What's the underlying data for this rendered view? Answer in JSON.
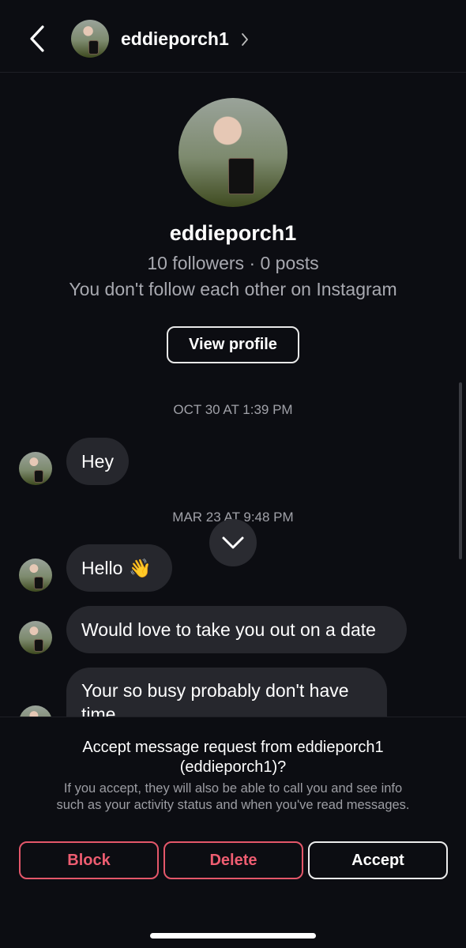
{
  "header": {
    "username": "eddieporch1"
  },
  "profile": {
    "name": "eddieporch1",
    "stats": "10 followers · 0 posts",
    "note": "You don't follow each other on Instagram",
    "view_profile_label": "View profile"
  },
  "thread": {
    "timestamp_1": "OCT 30 AT 1:39 PM",
    "timestamp_2": "MAR 23 AT 9:48 PM",
    "messages": [
      {
        "text": "Hey"
      },
      {
        "text": "Hello",
        "emoji": "👋"
      },
      {
        "text": "Would love to take you out on a date"
      },
      {
        "text": "Your so busy probably don't have time"
      }
    ]
  },
  "request": {
    "title_line1": "Accept message request from eddieporch1",
    "title_line2": "(eddieporch1)?",
    "description_line1": "If you accept, they will also be able to call you and see info",
    "description_line2": "such as your activity status and when you've read messages.",
    "block_label": "Block",
    "delete_label": "Delete",
    "accept_label": "Accept"
  },
  "colors": {
    "background": "#0c0d12",
    "bubble": "#26272d",
    "danger": "#ee5d71"
  },
  "icons": [
    "back-chevron-icon",
    "chevron-right-icon",
    "chevron-down-icon"
  ]
}
